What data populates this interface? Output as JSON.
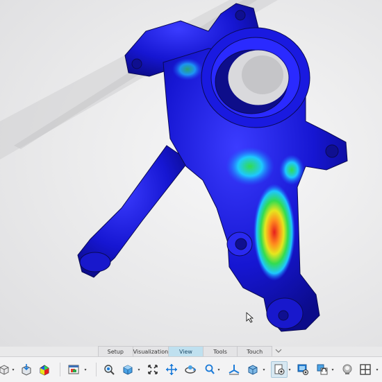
{
  "ribbon": {
    "tabs": [
      {
        "label": "Setup",
        "active": false
      },
      {
        "label": "Visualization",
        "active": false
      },
      {
        "label": "View",
        "active": true
      },
      {
        "label": "Tools",
        "active": false
      },
      {
        "label": "Touch",
        "active": false
      }
    ],
    "collapse_icon": "chevron-down-icon"
  },
  "viewport": {
    "model": "steering-knuckle",
    "color_map": [
      "#1414c8",
      "#1e5cff",
      "#1ec8ff",
      "#32dc50",
      "#e6e61e",
      "#ff8c1e",
      "#e61e1e"
    ]
  },
  "toolbar": {
    "icons": [
      "box-icon",
      "document-download-icon",
      "result-plot-icon",
      "window-layout-icon",
      "zoom-to-fit-icon",
      "view-cube-icon",
      "fit-all-icon",
      "pan-icon",
      "rotate-icon",
      "zoom-icon",
      "triad-axis-icon",
      "display-mode-icon",
      "section-settings-icon",
      "screen-capture-settings-icon",
      "view-sync-icon",
      "light-bulb-icon",
      "split-view-icon"
    ]
  }
}
